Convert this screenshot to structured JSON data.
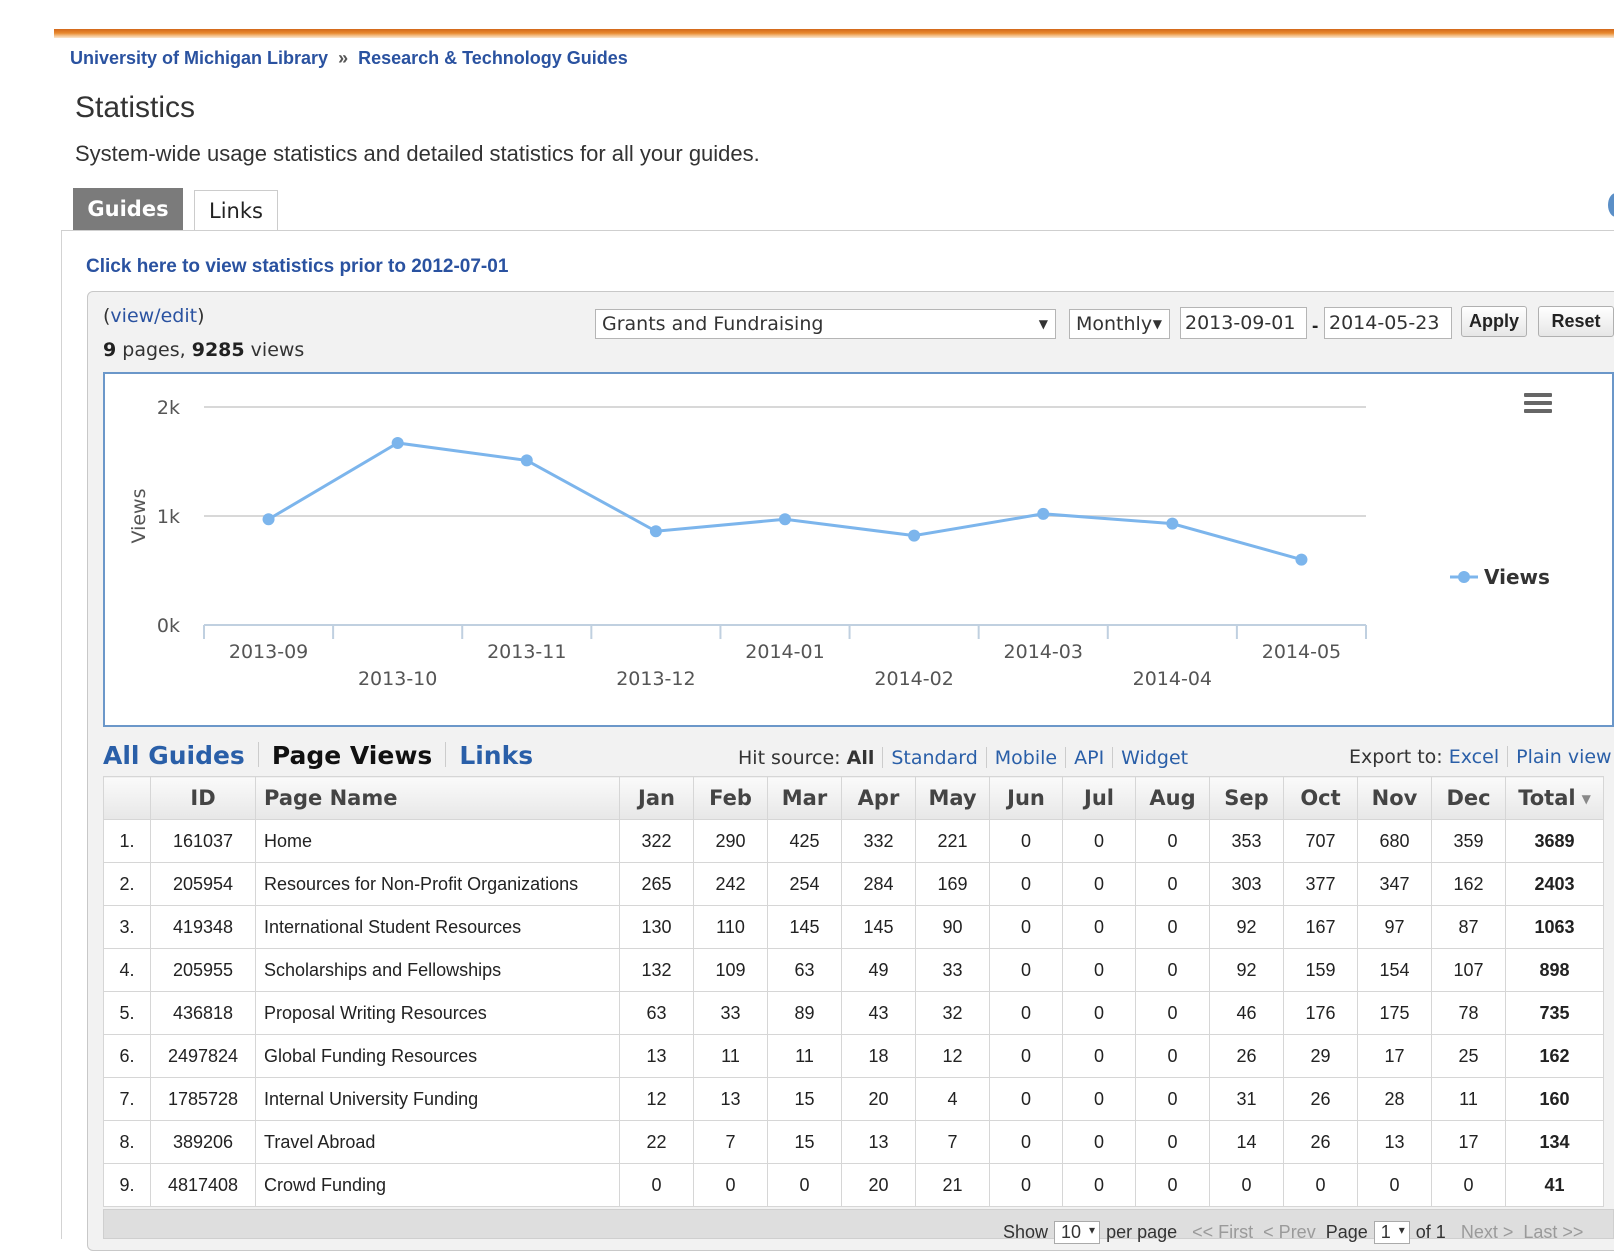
{
  "breadcrumb": {
    "home": "University of Michigan Library",
    "separator": "»",
    "section": "Research & Technology Guides"
  },
  "page": {
    "title": "Statistics",
    "subtitle": "System-wide usage statistics and detailed statistics for all your guides."
  },
  "tabs": {
    "guides": "Guides",
    "links": "Links"
  },
  "prior_link": "Click here to view statistics prior to 2012-07-01",
  "summary": {
    "view_open": "(",
    "view_edit": "view/edit",
    "view_close": ")",
    "pages": "9",
    "pages_label": "pages,",
    "views": "9285",
    "views_label": "views"
  },
  "filters": {
    "guide": "Grants and Fundraising",
    "interval": "Monthly",
    "start_date": "2013-09-01",
    "dash": "-",
    "end_date": "2014-05-23",
    "apply": "Apply",
    "reset": "Reset"
  },
  "chart_data": {
    "type": "line",
    "ylabel": "Views",
    "ylim": [
      0,
      2000
    ],
    "yticks": [
      "0k",
      "1k",
      "2k"
    ],
    "categories": [
      "2013-09",
      "2013-10",
      "2013-11",
      "2013-12",
      "2014-01",
      "2014-02",
      "2014-03",
      "2014-04",
      "2014-05"
    ],
    "series": [
      {
        "name": "Views",
        "values": [
          970,
          1670,
          1510,
          860,
          970,
          820,
          1020,
          930,
          600
        ]
      }
    ],
    "legend_position": "right",
    "grid": true,
    "color": "#7cb5ec"
  },
  "section_nav": {
    "all_guides": "All Guides",
    "page_views": "Page Views",
    "links": "Links"
  },
  "hit_source": {
    "label": "Hit source:",
    "all": "All",
    "standard": "Standard",
    "mobile": "Mobile",
    "api": "API",
    "widget": "Widget"
  },
  "export": {
    "label": "Export to:",
    "excel": "Excel",
    "plain": "Plain view"
  },
  "table": {
    "headers": [
      "",
      "ID",
      "Page Name",
      "Jan",
      "Feb",
      "Mar",
      "Apr",
      "May",
      "Jun",
      "Jul",
      "Aug",
      "Sep",
      "Oct",
      "Nov",
      "Dec",
      "Total"
    ],
    "rows": [
      [
        "1.",
        "161037",
        "Home",
        "322",
        "290",
        "425",
        "332",
        "221",
        "0",
        "0",
        "0",
        "353",
        "707",
        "680",
        "359",
        "3689"
      ],
      [
        "2.",
        "205954",
        "Resources for Non-Profit Organizations",
        "265",
        "242",
        "254",
        "284",
        "169",
        "0",
        "0",
        "0",
        "303",
        "377",
        "347",
        "162",
        "2403"
      ],
      [
        "3.",
        "419348",
        "International Student Resources",
        "130",
        "110",
        "145",
        "145",
        "90",
        "0",
        "0",
        "0",
        "92",
        "167",
        "97",
        "87",
        "1063"
      ],
      [
        "4.",
        "205955",
        "Scholarships and Fellowships",
        "132",
        "109",
        "63",
        "49",
        "33",
        "0",
        "0",
        "0",
        "92",
        "159",
        "154",
        "107",
        "898"
      ],
      [
        "5.",
        "436818",
        "Proposal Writing Resources",
        "63",
        "33",
        "89",
        "43",
        "32",
        "0",
        "0",
        "0",
        "46",
        "176",
        "175",
        "78",
        "735"
      ],
      [
        "6.",
        "2497824",
        "Global Funding Resources",
        "13",
        "11",
        "11",
        "18",
        "12",
        "0",
        "0",
        "0",
        "26",
        "29",
        "17",
        "25",
        "162"
      ],
      [
        "7.",
        "1785728",
        "Internal University Funding",
        "12",
        "13",
        "15",
        "20",
        "4",
        "0",
        "0",
        "0",
        "31",
        "26",
        "28",
        "11",
        "160"
      ],
      [
        "8.",
        "389206",
        "Travel Abroad",
        "22",
        "7",
        "15",
        "13",
        "7",
        "0",
        "0",
        "0",
        "14",
        "26",
        "13",
        "17",
        "134"
      ],
      [
        "9.",
        "4817408",
        "Crowd Funding",
        "0",
        "0",
        "0",
        "20",
        "21",
        "0",
        "0",
        "0",
        "0",
        "0",
        "0",
        "0",
        "41"
      ]
    ]
  },
  "pager": {
    "show": "Show",
    "per_page_value": "10",
    "per_page": "per page",
    "first": "<< First",
    "prev": "< Prev",
    "page": "Page",
    "page_value": "1",
    "of": "of 1",
    "next": "Next >",
    "last": "Last >>"
  },
  "icons": {
    "chart_menu": "hamburger-menu-icon",
    "sort": "sort-desc-icon"
  }
}
